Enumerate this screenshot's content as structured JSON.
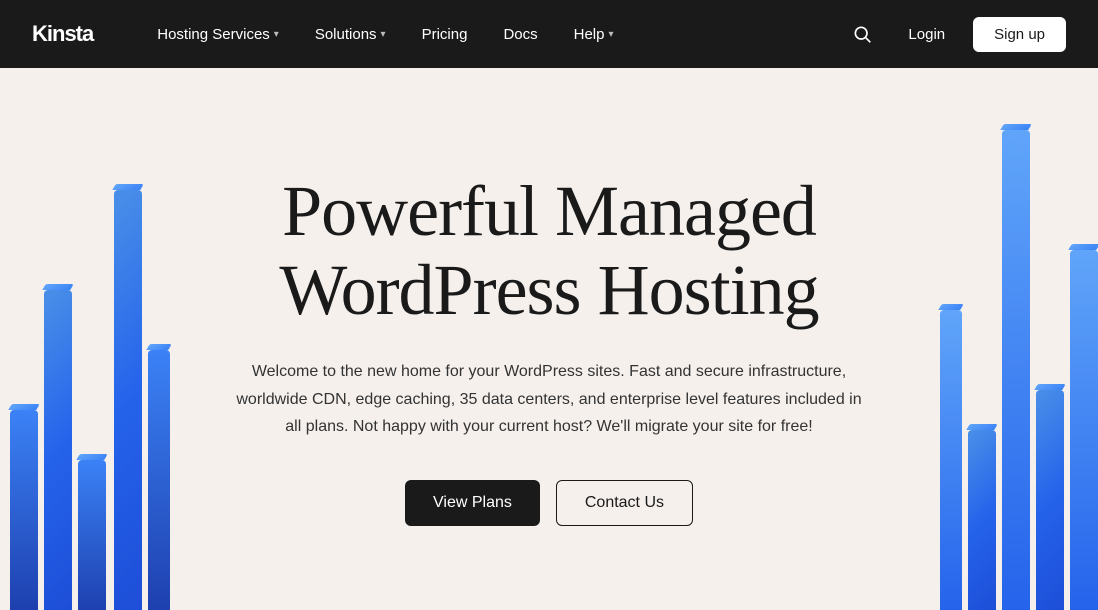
{
  "navbar": {
    "logo": "Kinsta",
    "nav_items": [
      {
        "label": "Hosting Services",
        "has_dropdown": true
      },
      {
        "label": "Solutions",
        "has_dropdown": true
      },
      {
        "label": "Pricing",
        "has_dropdown": false
      },
      {
        "label": "Docs",
        "has_dropdown": false
      },
      {
        "label": "Help",
        "has_dropdown": true
      }
    ],
    "login_label": "Login",
    "signup_label": "Sign up"
  },
  "hero": {
    "title_line1": "Powerful Managed",
    "title_line2": "WordPress Hosting",
    "subtitle": "Welcome to the new home for your WordPress sites. Fast and secure infrastructure, worldwide CDN, edge caching, 35 data centers, and enterprise level features included in all plans. Not happy with your current host? We'll migrate your site for free!",
    "btn_primary": "View Plans",
    "btn_secondary": "Contact Us"
  },
  "colors": {
    "navbar_bg": "#1a1a1a",
    "hero_bg": "#f5f0ec",
    "block_blue": "#2563eb",
    "text_dark": "#1a1a1a"
  }
}
